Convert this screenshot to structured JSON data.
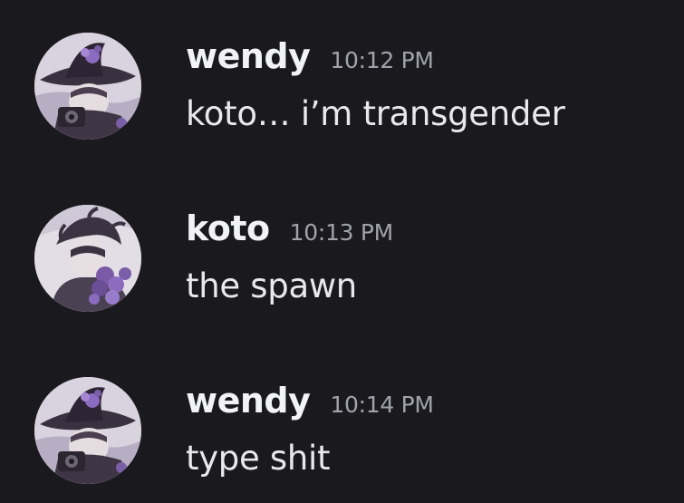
{
  "messages": [
    {
      "username": "wendy",
      "timestamp": "10:12 PM",
      "text": "koto… i’m transgender",
      "avatar": "witch-hat-camera-avatar"
    },
    {
      "username": "koto",
      "timestamp": "10:13 PM",
      "text": "the spawn",
      "avatar": "purple-flowers-avatar"
    },
    {
      "username": "wendy",
      "timestamp": "10:14 PM",
      "text": "type shit",
      "avatar": "witch-hat-camera-avatar"
    }
  ],
  "colors": {
    "background": "#1a1a1e",
    "username": "#f2f3f5",
    "timestamp": "#a0a3aa",
    "message_text": "#e8e9eb",
    "accent_purple": "#7b5ea8"
  }
}
